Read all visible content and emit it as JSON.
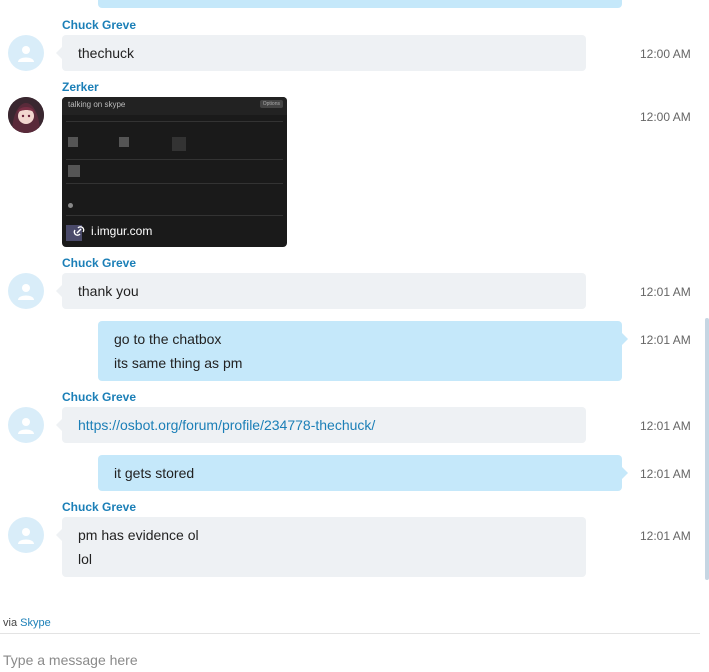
{
  "messages": {
    "m0": {
      "sender": "Chuck Greve",
      "text": "thechuck",
      "time": "12:00 AM"
    },
    "m1": {
      "sender": "Zerker",
      "time": "12:00 AM",
      "image": {
        "title": "talking on skype",
        "options": "Options",
        "domain": "i.imgur.com"
      }
    },
    "m2": {
      "sender": "Chuck Greve",
      "text": "thank you",
      "time": "12:01 AM"
    },
    "m3": {
      "lines": [
        "go to the chatbox",
        "its same thing as pm"
      ],
      "time": "12:01 AM"
    },
    "m4": {
      "sender": "Chuck Greve",
      "link": "https://osbot.org/forum/profile/234778-thechuck/",
      "time": "12:01 AM"
    },
    "m5": {
      "text": "it gets stored",
      "time": "12:01 AM"
    },
    "m6": {
      "sender": "Chuck Greve",
      "lines": [
        "pm has evidence ol",
        "lol"
      ],
      "time": "12:01 AM"
    }
  },
  "footer": {
    "via_prefix": "via",
    "via_app": "Skype"
  },
  "composer": {
    "placeholder": "Type a message here"
  },
  "colors": {
    "accent": "#1b7fb7",
    "outgoing_bubble": "#c5e8fa",
    "incoming_bubble": "#eef1f4"
  },
  "icons": {
    "default_avatar": "person-silhouette-icon",
    "link_badge": "link-icon"
  }
}
